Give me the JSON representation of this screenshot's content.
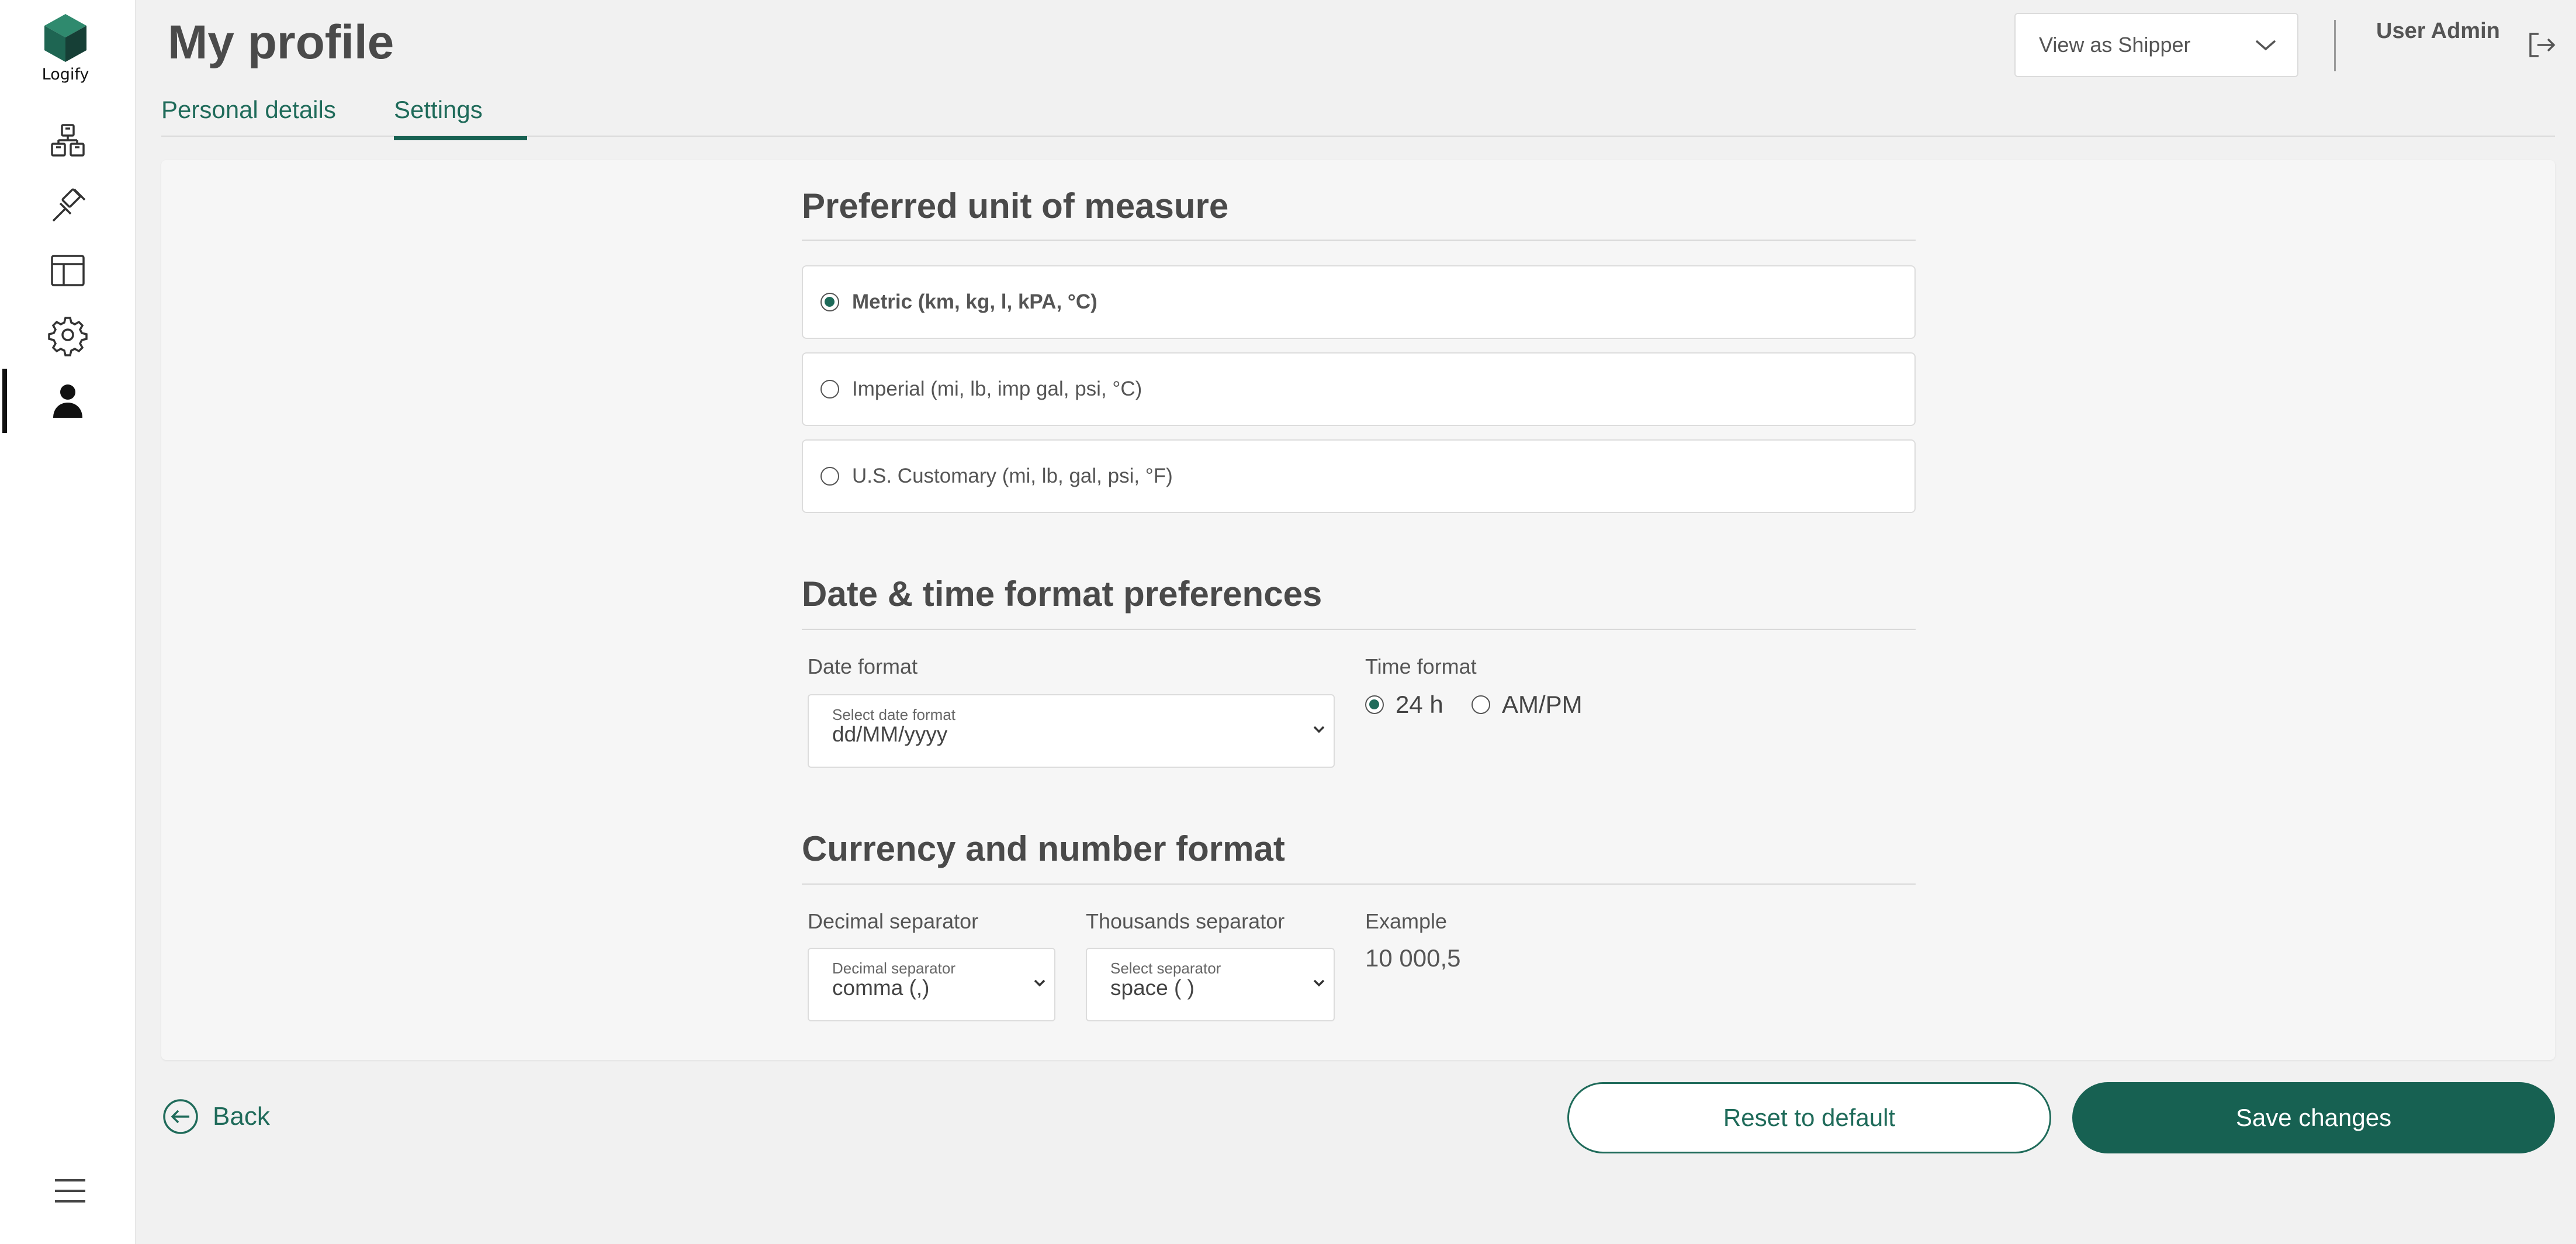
{
  "app": {
    "logo_text": "Logify"
  },
  "sidebar": {
    "items": [
      {
        "icon": "boxes-icon"
      },
      {
        "icon": "gavel-icon"
      },
      {
        "icon": "layout-icon"
      },
      {
        "icon": "gear-icon"
      },
      {
        "icon": "user-icon",
        "active": true
      }
    ],
    "menu_icon": "hamburger-icon"
  },
  "header": {
    "title": "My profile",
    "view_as": "View as Shipper",
    "user_name": "User Admin"
  },
  "tabs": [
    {
      "label": "Personal details",
      "active": false
    },
    {
      "label": "Settings",
      "active": true
    }
  ],
  "units": {
    "title": "Preferred unit of measure",
    "options": [
      {
        "label": "Metric (km, kg, l, kPA, °C)",
        "selected": true
      },
      {
        "label": "Imperial (mi, lb, imp gal, psi, °C)",
        "selected": false
      },
      {
        "label": "U.S. Customary (mi, lb, gal, psi, °F)",
        "selected": false
      }
    ]
  },
  "datetime": {
    "title": "Date & time format preferences",
    "date_label": "Date format",
    "date_select_hint": "Select date format",
    "date_value": "dd/MM/yyyy",
    "time_label": "Time format",
    "time_options": [
      {
        "label": "24 h",
        "selected": true
      },
      {
        "label": "AM/PM",
        "selected": false
      }
    ]
  },
  "currency": {
    "title": "Currency and number format",
    "decimal_label": "Decimal separator",
    "decimal_hint": "Decimal separator",
    "decimal_value": "comma (,)",
    "thousands_label": "Thousands separator",
    "thousands_hint": "Select separator",
    "thousands_value": "space ( )",
    "example_label": "Example",
    "example_value": "10 000,5"
  },
  "actions": {
    "back": "Back",
    "reset": "Reset to default",
    "save": "Save changes"
  },
  "colors": {
    "accent": "#176152",
    "link": "#1f6b5a"
  }
}
